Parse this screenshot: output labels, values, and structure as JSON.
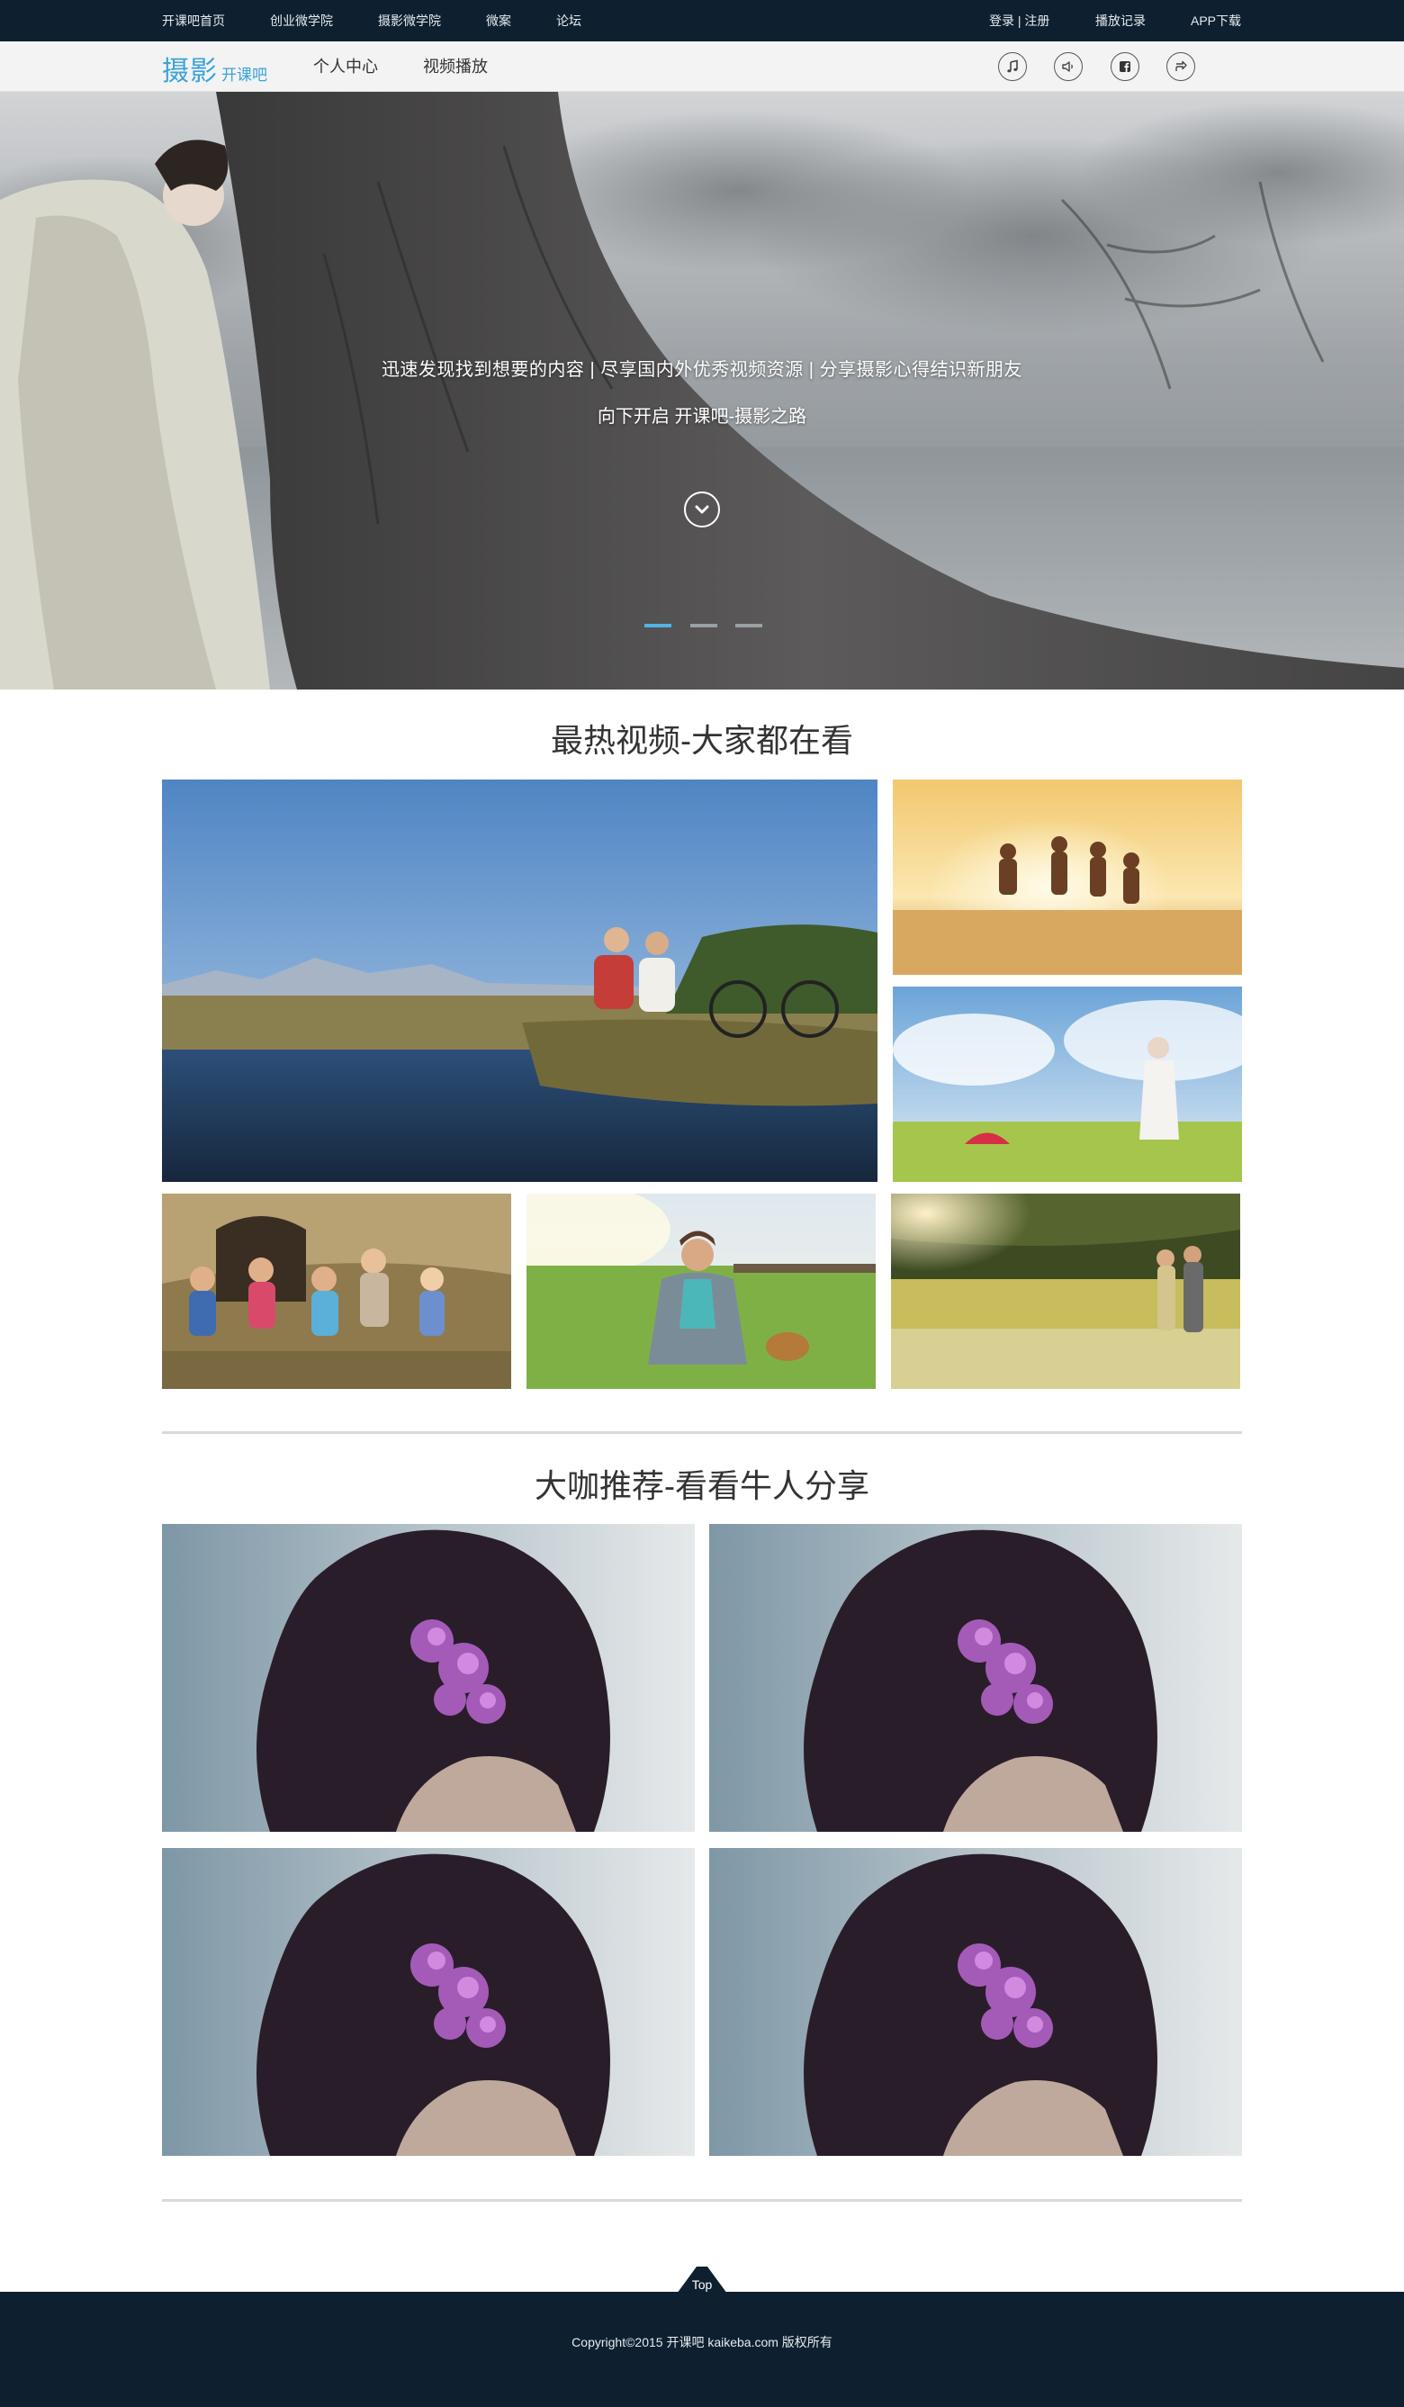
{
  "topbar": {
    "links": [
      "开课吧首页",
      "创业微学院",
      "摄影微学院",
      "微案",
      "论坛"
    ],
    "right_links": [
      "登录 | 注册",
      "播放记录",
      "APP下载"
    ]
  },
  "subnav": {
    "logo_main": "摄影",
    "logo_sub": "开课吧",
    "links": [
      "个人中心",
      "视频播放"
    ],
    "icons": [
      "music-icon",
      "volume-icon",
      "facebook-icon",
      "share-icon"
    ]
  },
  "hero": {
    "tagline": "迅速发现找到想要的内容 | 尽享国内外优秀视频资源 | 分享摄影心得结识新朋友",
    "subtitle": "向下开启 开课吧-摄影之路",
    "slides": 3,
    "active_slide": 1
  },
  "sections": {
    "hot_title": "最热视频-大家都在看",
    "recommend_title": "大咖推荐-看看牛人分享"
  },
  "footer": {
    "top_label": "Top",
    "copyright": "Copyright©2015 开课吧 kaikeba.com 版权所有"
  },
  "colors": {
    "dark_navy": "#0e2030",
    "accent_blue": "#3aa3d8",
    "slide_active": "#4fb3e6"
  }
}
